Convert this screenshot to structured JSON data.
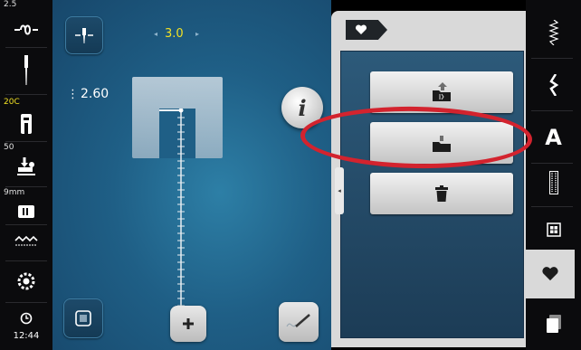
{
  "leftbar": {
    "needle_width": "2.5",
    "foot_code": "20C",
    "foot_pressure": "50",
    "stitch_plate": "9mm",
    "clock": "12:44",
    "icons": [
      "stitch-width-icon",
      "needle-icon",
      "presser-foot-icon",
      "presser-pressure-icon",
      "stitch-plate-icon",
      "feed-dog-icon",
      "bobbin-icon",
      "clock-icon"
    ]
  },
  "main": {
    "stitch_width": "3.0",
    "stitch_length": "2.60",
    "info_label": "i"
  },
  "panel": {
    "tab_icon": "heart-icon",
    "actions": [
      {
        "name": "save-to-folder",
        "icon": "folder-upload-icon"
      },
      {
        "name": "load-from-folder",
        "icon": "folder-download-icon"
      },
      {
        "name": "delete",
        "icon": "trash-icon"
      }
    ]
  },
  "rightbar": {
    "items": [
      "practical-stitches-icon",
      "decorative-stitches-icon",
      "alphabet-icon",
      "buttonhole-icon",
      "quilt-stitches-icon",
      "personal-program-icon",
      "memory-icon"
    ],
    "alphabet_label": "A",
    "active": "personal-program-icon"
  },
  "colors": {
    "accent_yellow": "#f1e024",
    "annotation_red": "#d3232e",
    "panel_gray": "#d9d9d9"
  }
}
